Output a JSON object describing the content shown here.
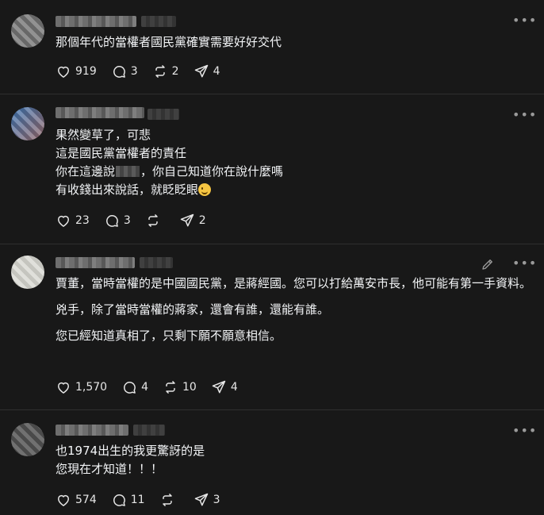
{
  "posts": [
    {
      "lines": [
        "那個年代的當權者國民黨確實需要好好交代"
      ],
      "actions": {
        "likes": "919",
        "comments": "3",
        "reposts": "2",
        "shares": "4"
      }
    },
    {
      "lines": [
        "果然變草了，可悲",
        "這是國民黨當權者的責任",
        "你在這邊說",
        "，你自己知道你在說什麼嗎",
        "有收錢出來說話，就眨眨眼"
      ],
      "actions": {
        "likes": "23",
        "comments": "3",
        "reposts": "",
        "shares": "2"
      }
    },
    {
      "paragraphs": [
        "賈董，當時當權的是中國國民黨，是蔣經國。您可以打給萬安市長，他可能有第一手資料。",
        "兇手，除了當時當權的蔣家，還會有誰，還能有誰。",
        "您已經知道真相了，只剩下願不願意相信。"
      ],
      "actions": {
        "likes": "1,570",
        "comments": "4",
        "reposts": "10",
        "shares": "4"
      }
    },
    {
      "lines": [
        "也1974出生的我更驚訝的是",
        "您現在才知道！！！"
      ],
      "actions": {
        "likes": "574",
        "comments": "11",
        "reposts": "",
        "shares": "3"
      }
    }
  ],
  "icons": {
    "more": "more-icon",
    "like": "heart-icon",
    "comment": "comment-icon",
    "repost": "repost-icon",
    "share": "share-icon",
    "edit": "pencil-icon"
  },
  "colors": {
    "background": "#181818",
    "text": "#f3f5f7",
    "icon": "#e6e6e6",
    "divider": "#2f2f2f"
  }
}
